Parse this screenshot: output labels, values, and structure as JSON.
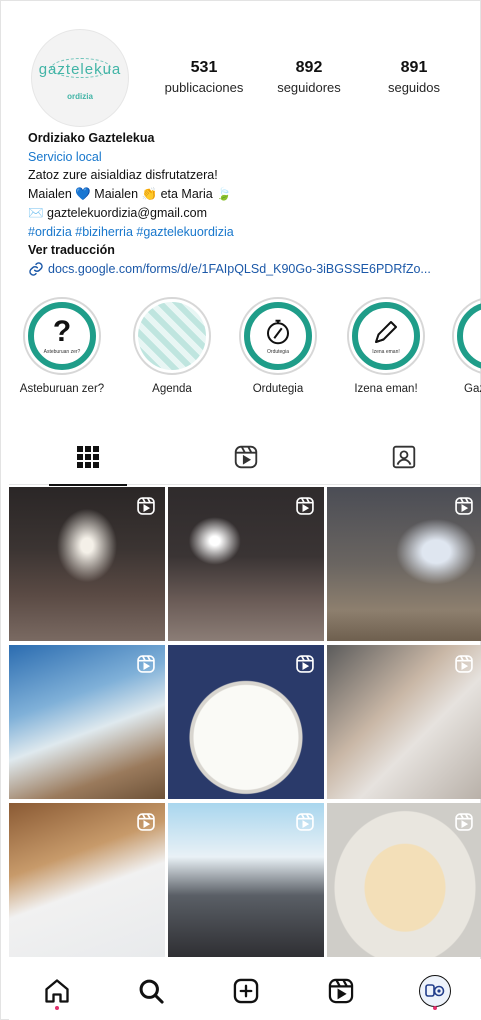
{
  "profile": {
    "avatar": {
      "logo_text": "gaztelekua",
      "logo_sub": "ordizia"
    },
    "stats": [
      {
        "value": "531",
        "label": "publicaciones"
      },
      {
        "value": "892",
        "label": "seguidores"
      },
      {
        "value": "891",
        "label": "seguidos"
      }
    ],
    "name": "Ordiziako Gaztelekua",
    "category": "Servicio local",
    "bio_line1": "Zatoz zure aisialdiaz disfrutatzera!",
    "bio_line2": "Maialen 💙 Maialen 👏 eta Maria 🍃",
    "email": "✉️ gaztelekuordizia@gmail.com",
    "hashtags": "#ordizia #biziherria #gaztelekuordizia",
    "translate": "Ver traducción",
    "link": "docs.google.com/forms/d/e/1FAIpQLSd_K90Go-3iBGSSE6PDRfZo..."
  },
  "highlights": [
    {
      "label": "Asteburuan zer?",
      "glyph": "?",
      "mini": "Asteburuan zer?"
    },
    {
      "label": "Agenda",
      "glyph": "",
      "mini": ""
    },
    {
      "label": "Ordutegia",
      "glyph": "⌚",
      "mini": "Ordutegia"
    },
    {
      "label": "Izena eman!",
      "glyph": "✎",
      "mini": "Izena eman!"
    },
    {
      "label": "Gaz",
      "glyph": "",
      "mini": ""
    }
  ],
  "tabs": [
    "grid",
    "reels",
    "tagged"
  ],
  "grid_posts": 9,
  "colors": {
    "accent": "#1f9d89",
    "link": "#1877cc",
    "notification": "#e1306c"
  }
}
